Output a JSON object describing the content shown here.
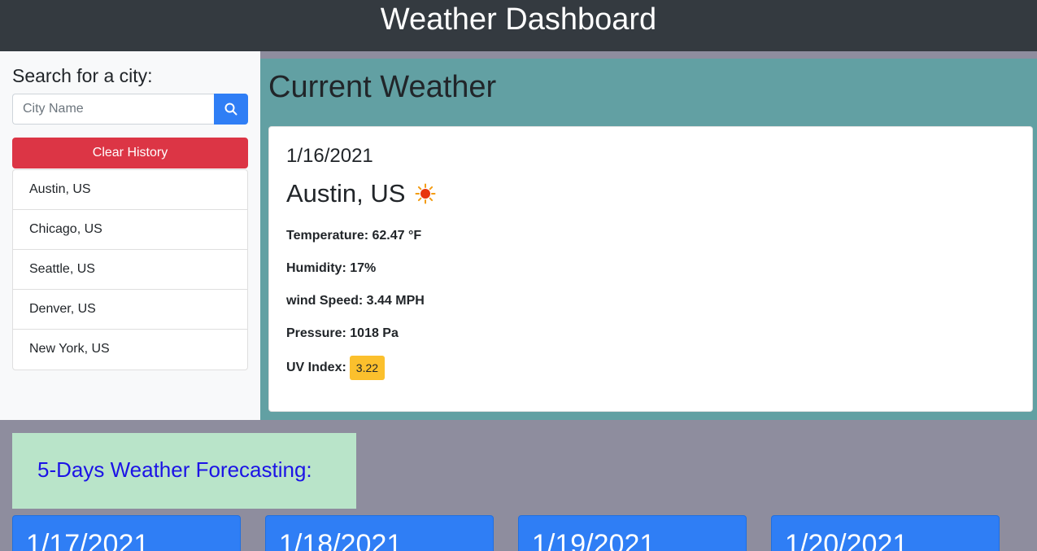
{
  "header": {
    "title": "Weather Dashboard"
  },
  "sidebar": {
    "search_heading": "Search for a city:",
    "search_placeholder": "City Name",
    "search_icon": "search-icon",
    "clear_label": "Clear History",
    "history": [
      "Austin, US",
      "Chicago, US",
      "Seattle, US",
      "Denver, US",
      "New York, US"
    ]
  },
  "current": {
    "heading": "Current Weather",
    "date": "1/16/2021",
    "city": "Austin, US",
    "icon": "sun-icon",
    "temperature": "Temperature: 62.47 °F",
    "humidity": "Humidity: 17%",
    "wind": "wind Speed: 3.44 MPH",
    "pressure": "Pressure: 1018 Pa",
    "uv_label": "UV Index:",
    "uv_value": "3.22"
  },
  "forecast": {
    "heading": "5-Days Weather Forecasting:",
    "days": [
      {
        "date": "1/17/2021"
      },
      {
        "date": "1/18/2021"
      },
      {
        "date": "1/19/2021"
      },
      {
        "date": "1/20/2021"
      }
    ]
  },
  "colors": {
    "header_bg": "#343a40",
    "page_bg": "#8e8d9e",
    "current_bg": "#62a0a3",
    "primary": "#2f7ef5",
    "danger": "#dc3545",
    "uv_badge": "#fbc02d",
    "forecast_title_bg": "#b9e4c9",
    "forecast_title_text": "#1c13e6"
  }
}
